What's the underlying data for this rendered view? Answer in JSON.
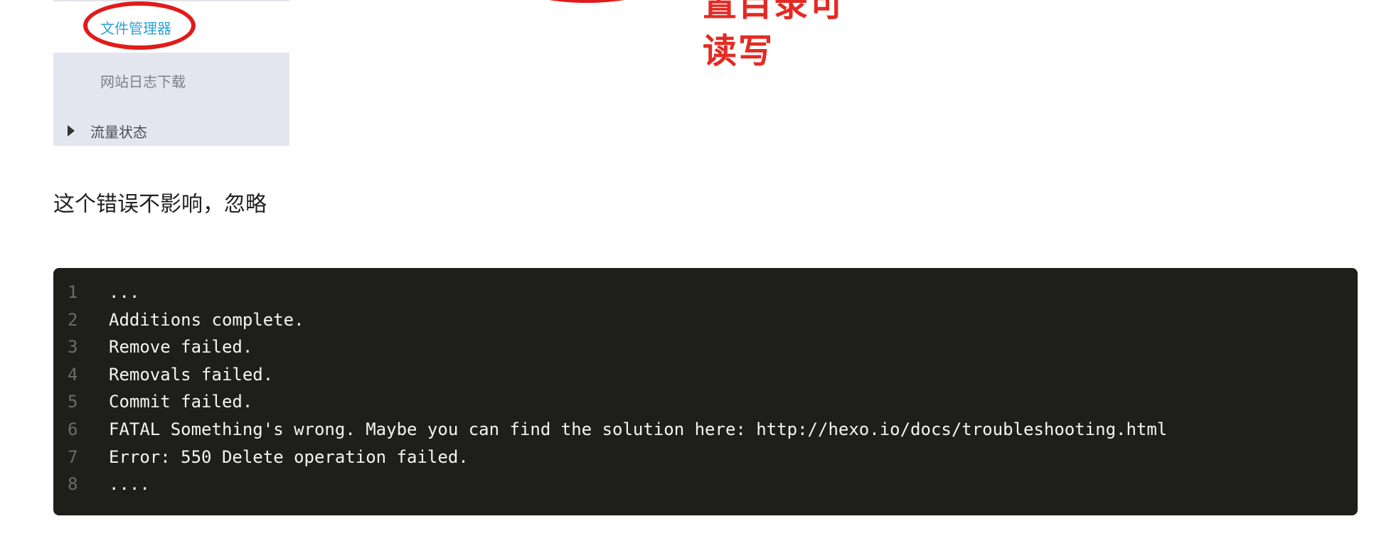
{
  "sidebar": {
    "items": [
      {
        "label": "文件管理器",
        "state": "highlighted"
      },
      {
        "label": "网站日志下载"
      },
      {
        "label": "流量状态",
        "icon": "caret-right-icon"
      }
    ]
  },
  "annotation": {
    "line1": "置目录可",
    "line2": "读写",
    "color": "#e42a23"
  },
  "paragraph": {
    "text": "这个错误不影响，忽略"
  },
  "code_block": {
    "lines": [
      {
        "number": "1",
        "text": "..."
      },
      {
        "number": "2",
        "text": "Additions complete."
      },
      {
        "number": "3",
        "text": "Remove failed."
      },
      {
        "number": "4",
        "text": "Removals failed."
      },
      {
        "number": "5",
        "text": "Commit failed."
      },
      {
        "number": "6",
        "text": "FATAL Something's wrong. Maybe you can find the solution here: http://hexo.io/docs/troubleshooting.html"
      },
      {
        "number": "7",
        "text": "Error: 550 Delete operation failed."
      },
      {
        "number": "8",
        "text": "...."
      }
    ],
    "background": "#1e1f1b"
  }
}
